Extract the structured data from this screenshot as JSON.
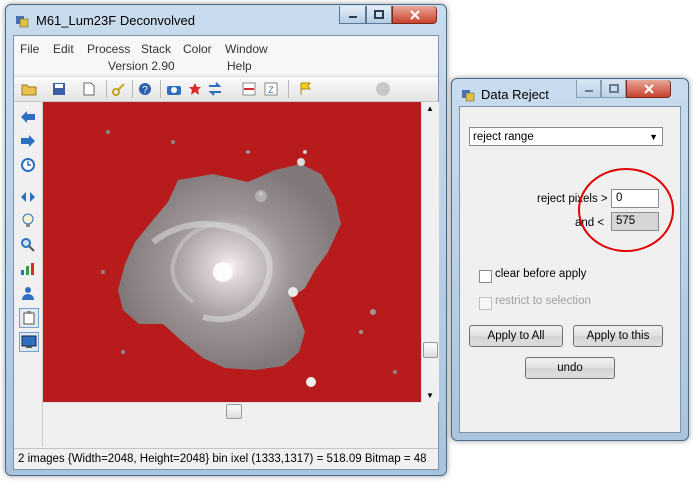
{
  "main_window": {
    "title": "M61_Lum23F Deconvolved",
    "menu": [
      "File",
      "Edit",
      "Process",
      "Stack",
      "Color",
      "Window"
    ],
    "menu_second_row": [
      "Version 2.90",
      "Help"
    ],
    "status_text": "2 images  {Width=2048, Height=2048} bin  ixel (1333,1317) = 518.09  Bitmap = 48"
  },
  "dialog": {
    "title": "Data Reject",
    "mode_select_value": "reject range",
    "reject_label": "reject pixels >",
    "reject_value": "0",
    "and_label": "and <",
    "and_value": "575",
    "clear_label": "clear before apply",
    "restrict_label": "restrict to selection",
    "apply_all_label": "Apply to All",
    "apply_this_label": "Apply to this",
    "undo_label": "undo"
  },
  "colors": {
    "reject_overlay": "#b81b1b",
    "annotation_circle": "#e00000"
  }
}
